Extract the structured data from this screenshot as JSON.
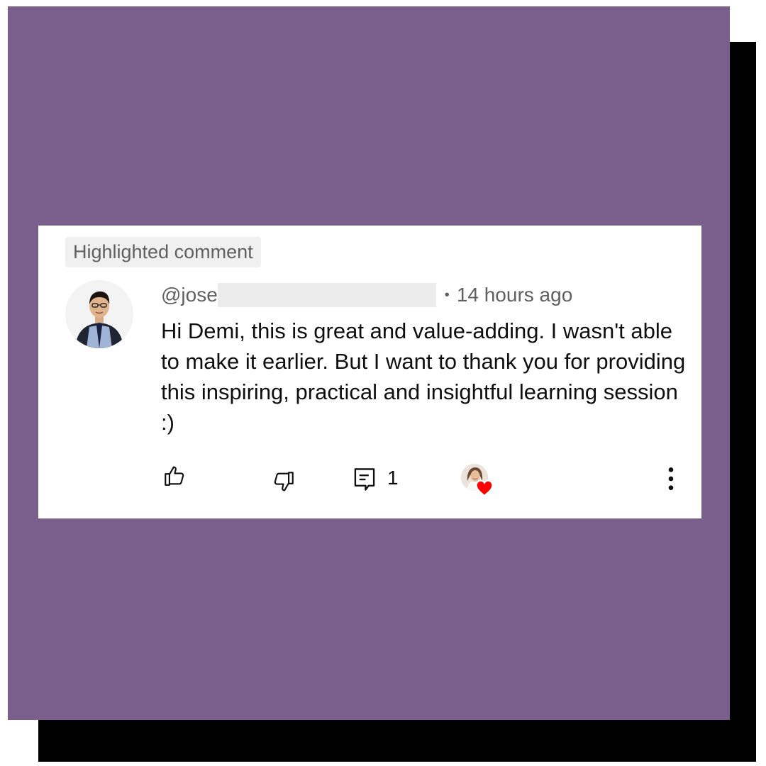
{
  "badge": {
    "label": "Highlighted comment"
  },
  "comment": {
    "author": "@jose",
    "separator": "•",
    "timestamp": "14 hours ago",
    "text": "Hi Demi, this is great and value-adding. I wasn't able to make it earlier. But I want to thank you for providing this inspiring, practical and insightful learning session :)"
  },
  "actions": {
    "reply_count": "1",
    "icons": [
      "thumbs-up-icon",
      "thumbs-down-icon",
      "reply-icon",
      "creator-heart-icon",
      "more-vert-icon"
    ]
  },
  "colors": {
    "background_panel": "#7a5e8c",
    "shadow": "#000000",
    "card": "#ffffff",
    "badge_bg": "#f0f0f0",
    "secondary_text": "#606060",
    "primary_text": "#0f0f0f",
    "heart": "#ff0000"
  }
}
